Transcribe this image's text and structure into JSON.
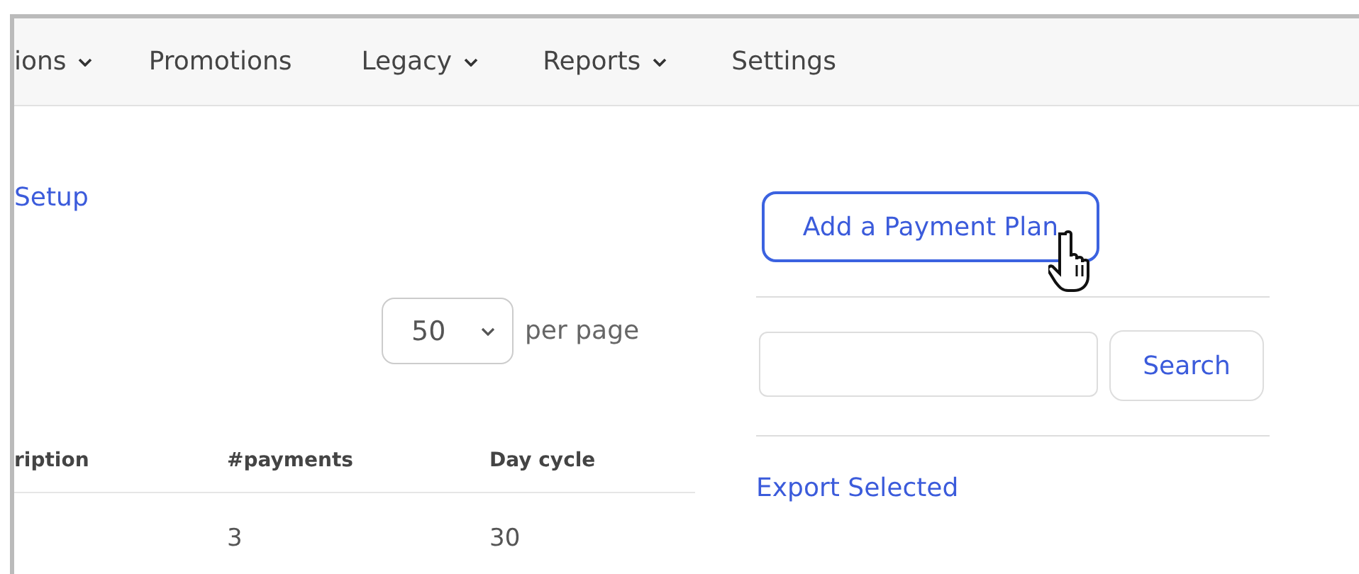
{
  "nav": [
    {
      "label": "ions",
      "dropdown": true
    },
    {
      "label": "Promotions",
      "dropdown": false
    },
    {
      "label": "Legacy",
      "dropdown": true
    },
    {
      "label": "Reports",
      "dropdown": true
    },
    {
      "label": "Settings",
      "dropdown": false
    }
  ],
  "setup_link": "Setup",
  "per_page": {
    "value": "50",
    "label": "per page"
  },
  "table": {
    "columns": [
      "ription",
      "#payments",
      "Day cycle"
    ],
    "rows": [
      [
        "",
        "3",
        "30"
      ]
    ]
  },
  "add_button": "Add a Payment Plan",
  "search": {
    "button": "Search"
  },
  "export_link": "Export Selected"
}
